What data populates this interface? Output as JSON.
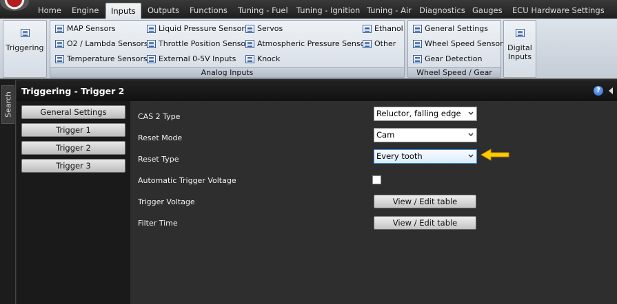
{
  "menu": {
    "tabs": [
      {
        "label": "Home"
      },
      {
        "label": "Engine"
      },
      {
        "label": "Inputs"
      },
      {
        "label": "Outputs"
      },
      {
        "label": "Functions"
      },
      {
        "label": "Tuning - Fuel"
      },
      {
        "label": "Tuning - Ignition"
      },
      {
        "label": "Tuning - Air"
      },
      {
        "label": "Diagnostics"
      },
      {
        "label": "Gauges"
      },
      {
        "label": "ECU Hardware Settings"
      }
    ],
    "active_tab": "Inputs"
  },
  "ribbon": {
    "triggering": {
      "label": "Triggering"
    },
    "analog_inputs": {
      "group_label": "Analog Inputs",
      "items": [
        "MAP Sensors",
        "O2 / Lambda Sensors",
        "Temperature Sensors",
        "Liquid Pressure Sensors",
        "Throttle Position Sensor",
        "External 0-5V Inputs",
        "Servos",
        "Atmospheric Pressure Sensor",
        "Knock",
        "Ethanol",
        "Other"
      ]
    },
    "wheel_speed_gear": {
      "group_label": "Wheel Speed / Gear",
      "items": [
        "General Settings",
        "Wheel Speed Sensor",
        "Gear Detection"
      ]
    },
    "digital_inputs": {
      "label_line1": "Digital",
      "label_line2": "Inputs"
    }
  },
  "sidebar": {
    "search_label": "Search"
  },
  "panel": {
    "title": "Triggering - Trigger 2",
    "help_icon": "?",
    "nav": [
      "General Settings",
      "Trigger 1",
      "Trigger 2",
      "Trigger 3"
    ],
    "settings": {
      "cas2_type": {
        "label": "CAS 2 Type",
        "value": "Reluctor, falling edge"
      },
      "reset_mode": {
        "label": "Reset Mode",
        "value": "Cam"
      },
      "reset_type": {
        "label": "Reset Type",
        "value": "Every tooth"
      },
      "auto_trigger_voltage": {
        "label": "Automatic Trigger Voltage",
        "checked": false
      },
      "trigger_voltage": {
        "label": "Trigger Voltage",
        "button": "View / Edit table"
      },
      "filter_time": {
        "label": "Filter Time",
        "button": "View / Edit table"
      }
    }
  },
  "colors": {
    "arrow": "#ffcc00",
    "highlight_border": "#3c8de0",
    "panel_bg": "#2e2e2e"
  }
}
